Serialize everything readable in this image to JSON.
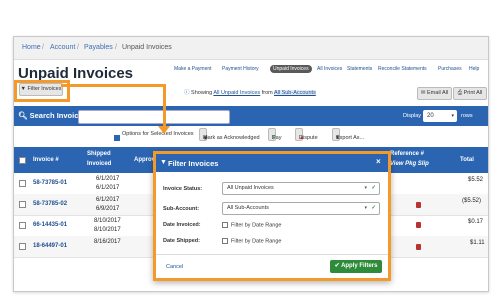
{
  "breadcrumb": [
    "Home",
    "Account",
    "Payables",
    "Unpaid Invoices"
  ],
  "page_title": "Unpaid Invoices",
  "top_nav": [
    {
      "label": "Make a Payment"
    },
    {
      "label": "Payment History"
    },
    {
      "label": "Unpaid Invoices",
      "active": true
    },
    {
      "label": "All Invoices"
    },
    {
      "label": "Statements"
    },
    {
      "label": "Reconcile Statements"
    },
    {
      "label": "Purchases"
    },
    {
      "label": "Help"
    }
  ],
  "filter_button": "Filter Invoices",
  "info_text": {
    "prefix": "Showing",
    "link": "All Unpaid Invoices",
    "mid": "from",
    "highlight": "All Sub-Accounts"
  },
  "email_all": "Email All",
  "print_all": "Print All",
  "search": {
    "label": "Search Invoices:",
    "display_label": "Display",
    "display_value": "20",
    "rows_label": "rows"
  },
  "actions": {
    "options": "Options for Selected Invoices",
    "mark_ack": "Mark as Acknowledged",
    "pay": "Pay",
    "dispute": "Dispute",
    "export": "Export As..."
  },
  "table": {
    "headers": [
      "Invoice #",
      "Shipped",
      "Invoiced",
      "Approved",
      "Reference #",
      "View Pkg Slip",
      "Total"
    ],
    "rows": [
      {
        "invoice": "58-73785-01",
        "shipped": "6/1/2017",
        "invoiced": "6/1/2017",
        "total": "$5.52"
      },
      {
        "invoice": "58-73785-02",
        "shipped": "6/1/2017",
        "invoiced": "6/9/2017",
        "total": "($5.52)"
      },
      {
        "invoice": "66-14435-01",
        "shipped": "8/10/2017",
        "invoiced": "8/10/2017",
        "total": "$0.17"
      },
      {
        "invoice": "18-64497-01",
        "shipped": "8/16/2017",
        "invoiced": "",
        "total": "$1.11"
      }
    ]
  },
  "modal": {
    "title": "Filter Invoices",
    "invoice_status_label": "Invoice Status:",
    "invoice_status_value": "All Unpaid Invoices",
    "sub_account_label": "Sub-Account:",
    "sub_account_value": "All Sub-Accounts",
    "date_invoiced_label": "Date Invoiced:",
    "date_invoiced_option": "Filter by Date Range",
    "date_shipped_label": "Date Shipped:",
    "date_shipped_option": "Filter by Date Range",
    "cancel": "Cancel",
    "apply": "Apply Filters"
  },
  "colors": {
    "primary": "#2b65b1",
    "highlight": "#f39a2b",
    "apply": "#2e8b3a"
  }
}
